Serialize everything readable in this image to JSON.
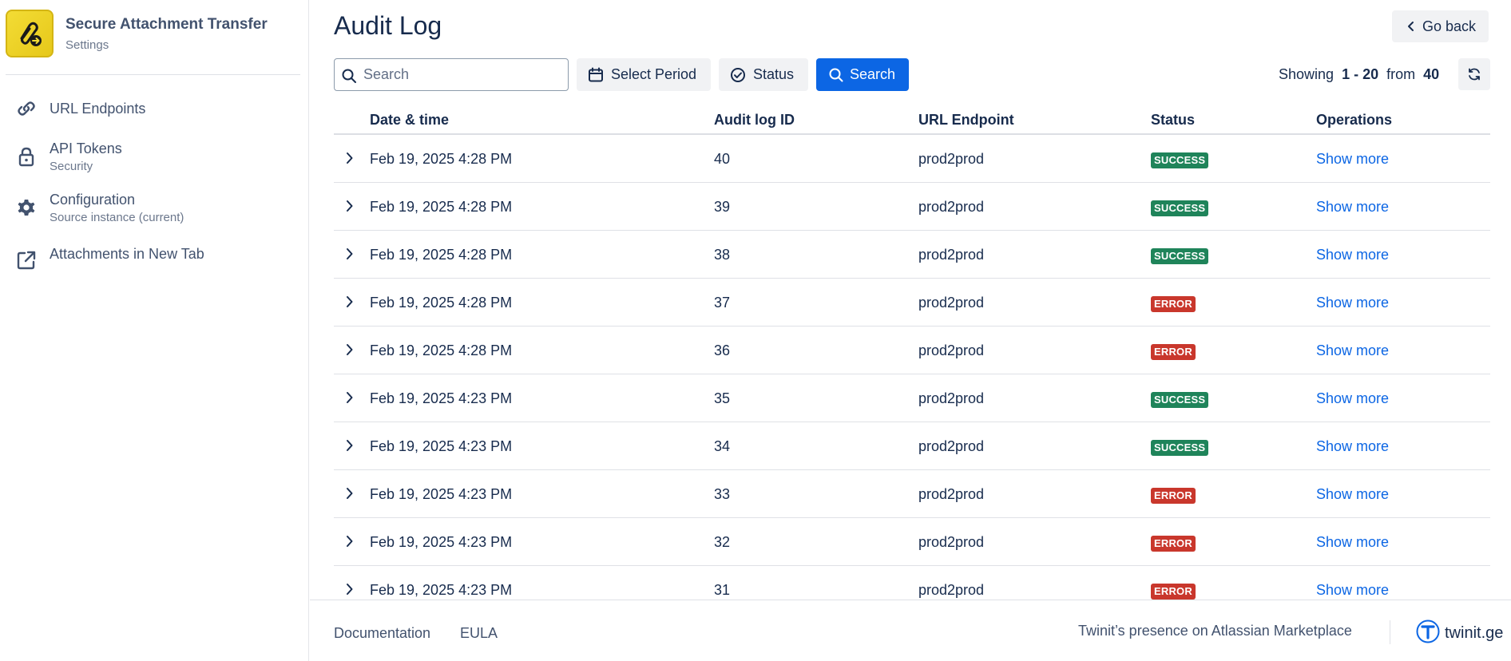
{
  "app": {
    "title": "Secure Attachment Transfer",
    "subtitle": "Settings",
    "logo_color": "#f3dc35"
  },
  "sidebar": {
    "items": [
      {
        "label": "URL Endpoints",
        "sublabel": "",
        "icon": "link-icon"
      },
      {
        "label": "API Tokens",
        "sublabel": "Security",
        "icon": "lock-icon"
      },
      {
        "label": "Configuration",
        "sublabel": "Source instance (current)",
        "icon": "gear-icon"
      },
      {
        "label": "Attachments in New Tab",
        "sublabel": "",
        "icon": "external-link-icon"
      }
    ]
  },
  "page": {
    "title": "Audit Log",
    "go_back_label": "Go back"
  },
  "toolbar": {
    "search_placeholder": "Search",
    "search_value": "",
    "select_period_label": "Select Period",
    "status_label": "Status",
    "search_button_label": "Search",
    "showing_prefix": "Showing",
    "showing_range": "1 - 20",
    "showing_from": "from",
    "showing_total": "40"
  },
  "table": {
    "columns": [
      "Date & time",
      "Audit log ID",
      "URL Endpoint",
      "Status",
      "Operations"
    ],
    "rows": [
      {
        "date": "Feb 19, 2025 4:28 PM",
        "id": "40",
        "endpoint": "prod2prod",
        "status": "SUCCESS",
        "operation": "Show more"
      },
      {
        "date": "Feb 19, 2025 4:28 PM",
        "id": "39",
        "endpoint": "prod2prod",
        "status": "SUCCESS",
        "operation": "Show more"
      },
      {
        "date": "Feb 19, 2025 4:28 PM",
        "id": "38",
        "endpoint": "prod2prod",
        "status": "SUCCESS",
        "operation": "Show more"
      },
      {
        "date": "Feb 19, 2025 4:28 PM",
        "id": "37",
        "endpoint": "prod2prod",
        "status": "ERROR",
        "operation": "Show more"
      },
      {
        "date": "Feb 19, 2025 4:28 PM",
        "id": "36",
        "endpoint": "prod2prod",
        "status": "ERROR",
        "operation": "Show more"
      },
      {
        "date": "Feb 19, 2025 4:23 PM",
        "id": "35",
        "endpoint": "prod2prod",
        "status": "SUCCESS",
        "operation": "Show more"
      },
      {
        "date": "Feb 19, 2025 4:23 PM",
        "id": "34",
        "endpoint": "prod2prod",
        "status": "SUCCESS",
        "operation": "Show more"
      },
      {
        "date": "Feb 19, 2025 4:23 PM",
        "id": "33",
        "endpoint": "prod2prod",
        "status": "ERROR",
        "operation": "Show more"
      },
      {
        "date": "Feb 19, 2025 4:23 PM",
        "id": "32",
        "endpoint": "prod2prod",
        "status": "ERROR",
        "operation": "Show more"
      },
      {
        "date": "Feb 19, 2025 4:23 PM",
        "id": "31",
        "endpoint": "prod2prod",
        "status": "ERROR",
        "operation": "Show more"
      }
    ]
  },
  "footer": {
    "documentation_label": "Documentation",
    "eula_label": "EULA",
    "marketplace_label": "Twinit’s presence on Atlassian Marketplace",
    "brand_label": "twinit.ge"
  },
  "colors": {
    "primary": "#0c66e4",
    "success": "#1f845a",
    "error": "#c9372c",
    "text": "#172b4d",
    "subtle": "#42526e"
  }
}
